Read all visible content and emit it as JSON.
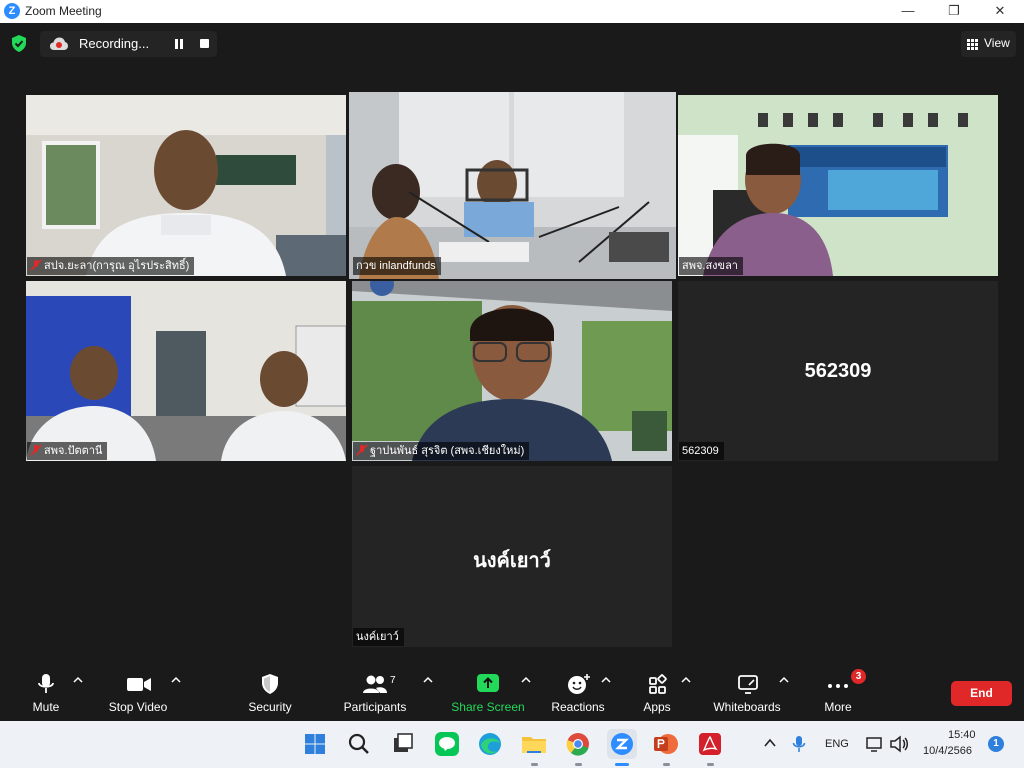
{
  "window": {
    "title": "Zoom Meeting",
    "logo_letter": "Z",
    "minimize": "—",
    "maximize": "❐",
    "close": "✕"
  },
  "topbar": {
    "recording_label": "Recording...",
    "view_label": "View"
  },
  "tiles": [
    {
      "name": "สปจ.ยะลา(การุณ  อุไรประสิทธิ์)"
    },
    {
      "name": "กวข inlandfunds"
    },
    {
      "name": "สพจ.สงขลา"
    },
    {
      "name": "สพจ.ปัตตานี"
    },
    {
      "name": "ฐาปนพันธ์ สุรจิต (สพจ.เชียงใหม่)"
    },
    {
      "name": "562309",
      "display_name": "562309"
    },
    {
      "name": "นงค์เยาว์",
      "display_name": "นงค์เยาว์"
    }
  ],
  "toolbar": {
    "mute": "Mute",
    "stop_video": "Stop Video",
    "security": "Security",
    "participants": "Participants",
    "participants_count": "7",
    "share_screen": "Share Screen",
    "reactions": "Reactions",
    "apps": "Apps",
    "whiteboards": "Whiteboards",
    "more": "More",
    "more_badge": "3",
    "end": "End"
  },
  "taskbar": {
    "language": "ENG",
    "time": "15:40",
    "date": "10/4/2566",
    "notification_count": "1"
  },
  "colors": {
    "active_speaker": "#c8e14b",
    "share_green": "#23d959",
    "end_red": "#e02828",
    "zoom_blue": "#2d8cff"
  }
}
